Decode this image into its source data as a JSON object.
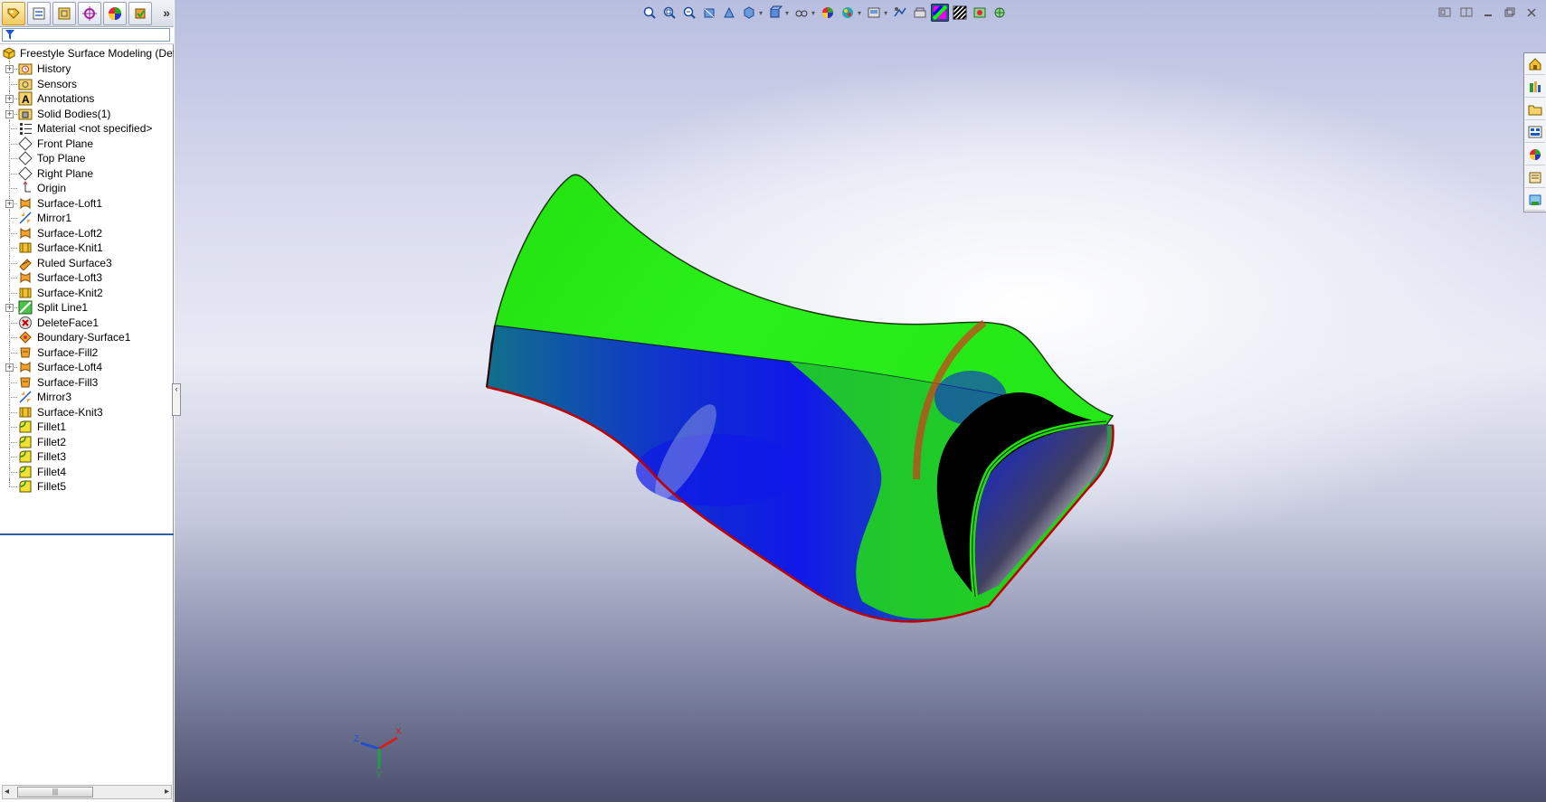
{
  "feature_tree": {
    "tabs": [
      "featuremanager-tab",
      "propertymanager-tab",
      "configurationmanager-tab",
      "dimxpert-tab",
      "display-manager-tab",
      "custom-tab"
    ],
    "more_glyph": "»",
    "filter_icon": "filter-icon",
    "root_label": "Freestyle Surface Modeling  (Def",
    "items": [
      {
        "label": "History",
        "icon": "history-folder-icon",
        "expandable": true
      },
      {
        "label": "Sensors",
        "icon": "sensors-folder-icon",
        "expandable": false
      },
      {
        "label": "Annotations",
        "icon": "annotations-icon",
        "expandable": true
      },
      {
        "label": "Solid Bodies(1)",
        "icon": "solid-bodies-folder-icon",
        "expandable": true
      },
      {
        "label": "Material <not specified>",
        "icon": "material-icon",
        "expandable": false
      },
      {
        "label": "Front Plane",
        "icon": "plane-icon",
        "expandable": false
      },
      {
        "label": "Top Plane",
        "icon": "plane-icon",
        "expandable": false
      },
      {
        "label": "Right Plane",
        "icon": "plane-icon",
        "expandable": false
      },
      {
        "label": "Origin",
        "icon": "origin-icon",
        "expandable": false
      },
      {
        "label": "Surface-Loft1",
        "icon": "surface-loft-icon",
        "expandable": true
      },
      {
        "label": "Mirror1",
        "icon": "mirror-icon",
        "expandable": false
      },
      {
        "label": "Surface-Loft2",
        "icon": "surface-loft-icon",
        "expandable": false
      },
      {
        "label": "Surface-Knit1",
        "icon": "surface-knit-icon",
        "expandable": false
      },
      {
        "label": "Ruled Surface3",
        "icon": "ruled-surface-icon",
        "expandable": false
      },
      {
        "label": "Surface-Loft3",
        "icon": "surface-loft-icon",
        "expandable": false
      },
      {
        "label": "Surface-Knit2",
        "icon": "surface-knit-icon",
        "expandable": false
      },
      {
        "label": "Split Line1",
        "icon": "split-line-icon",
        "expandable": true
      },
      {
        "label": "DeleteFace1",
        "icon": "delete-face-icon",
        "expandable": false
      },
      {
        "label": "Boundary-Surface1",
        "icon": "boundary-surface-icon",
        "expandable": false
      },
      {
        "label": "Surface-Fill2",
        "icon": "surface-fill-icon",
        "expandable": false
      },
      {
        "label": "Surface-Loft4",
        "icon": "surface-loft-icon",
        "expandable": true
      },
      {
        "label": "Surface-Fill3",
        "icon": "surface-fill-icon",
        "expandable": false
      },
      {
        "label": "Mirror3",
        "icon": "mirror-icon",
        "expandable": false
      },
      {
        "label": "Surface-Knit3",
        "icon": "surface-knit-icon",
        "expandable": false
      },
      {
        "label": "Fillet1",
        "icon": "fillet-icon",
        "expandable": false
      },
      {
        "label": "Fillet2",
        "icon": "fillet-icon",
        "expandable": false
      },
      {
        "label": "Fillet3",
        "icon": "fillet-icon",
        "expandable": false
      },
      {
        "label": "Fillet4",
        "icon": "fillet-icon",
        "expandable": false
      },
      {
        "label": "Fillet5",
        "icon": "fillet-icon",
        "expandable": false
      }
    ],
    "expander_glyph": "+",
    "collapse_glyph": "‹",
    "scroll": {
      "left": "◂",
      "right": "▸",
      "grip": "|||"
    }
  },
  "heads_up_toolbar": [
    {
      "name": "zoom-to-fit-icon"
    },
    {
      "name": "zoom-to-area-icon"
    },
    {
      "name": "previous-view-icon"
    },
    {
      "name": "section-view-icon"
    },
    {
      "name": "dynamic-annotation-icon"
    },
    {
      "name": "view-orientation-icon",
      "dropdown": true
    },
    {
      "name": "display-style-icon",
      "dropdown": true
    },
    {
      "name": "hide-show-items-icon",
      "dropdown": true
    },
    {
      "name": "edit-appearance-icon"
    },
    {
      "name": "apply-scene-icon",
      "dropdown": true
    },
    {
      "name": "view-settings-icon",
      "dropdown": true
    },
    {
      "name": "draft-analysis-icon"
    },
    {
      "name": "undercut-analysis-icon"
    },
    {
      "name": "curvature-icon",
      "active": true
    },
    {
      "name": "zebra-stripes-icon"
    },
    {
      "name": "rendering-tools-icon"
    },
    {
      "name": "photoview-icon"
    }
  ],
  "dropdown_glyph": "▾",
  "window_controls": [
    "restore-viewport-icon",
    "split-viewport-icon",
    "minimize-icon",
    "restore-icon",
    "close-icon"
  ],
  "task_pane": [
    "resources-icon",
    "design-library-icon",
    "file-explorer-icon",
    "view-palette-icon",
    "appearances-icon",
    "custom-properties-icon",
    "solidworks-forum-icon"
  ],
  "triad_axes": {
    "x": "X",
    "y": "Y",
    "z": "Z"
  },
  "colors": {
    "surface_green": "#22e010",
    "surface_blue": "#1018e8",
    "curvature_red": "#c8441a",
    "edge_red": "#c00000",
    "selection_blue": "#2e5da8"
  }
}
